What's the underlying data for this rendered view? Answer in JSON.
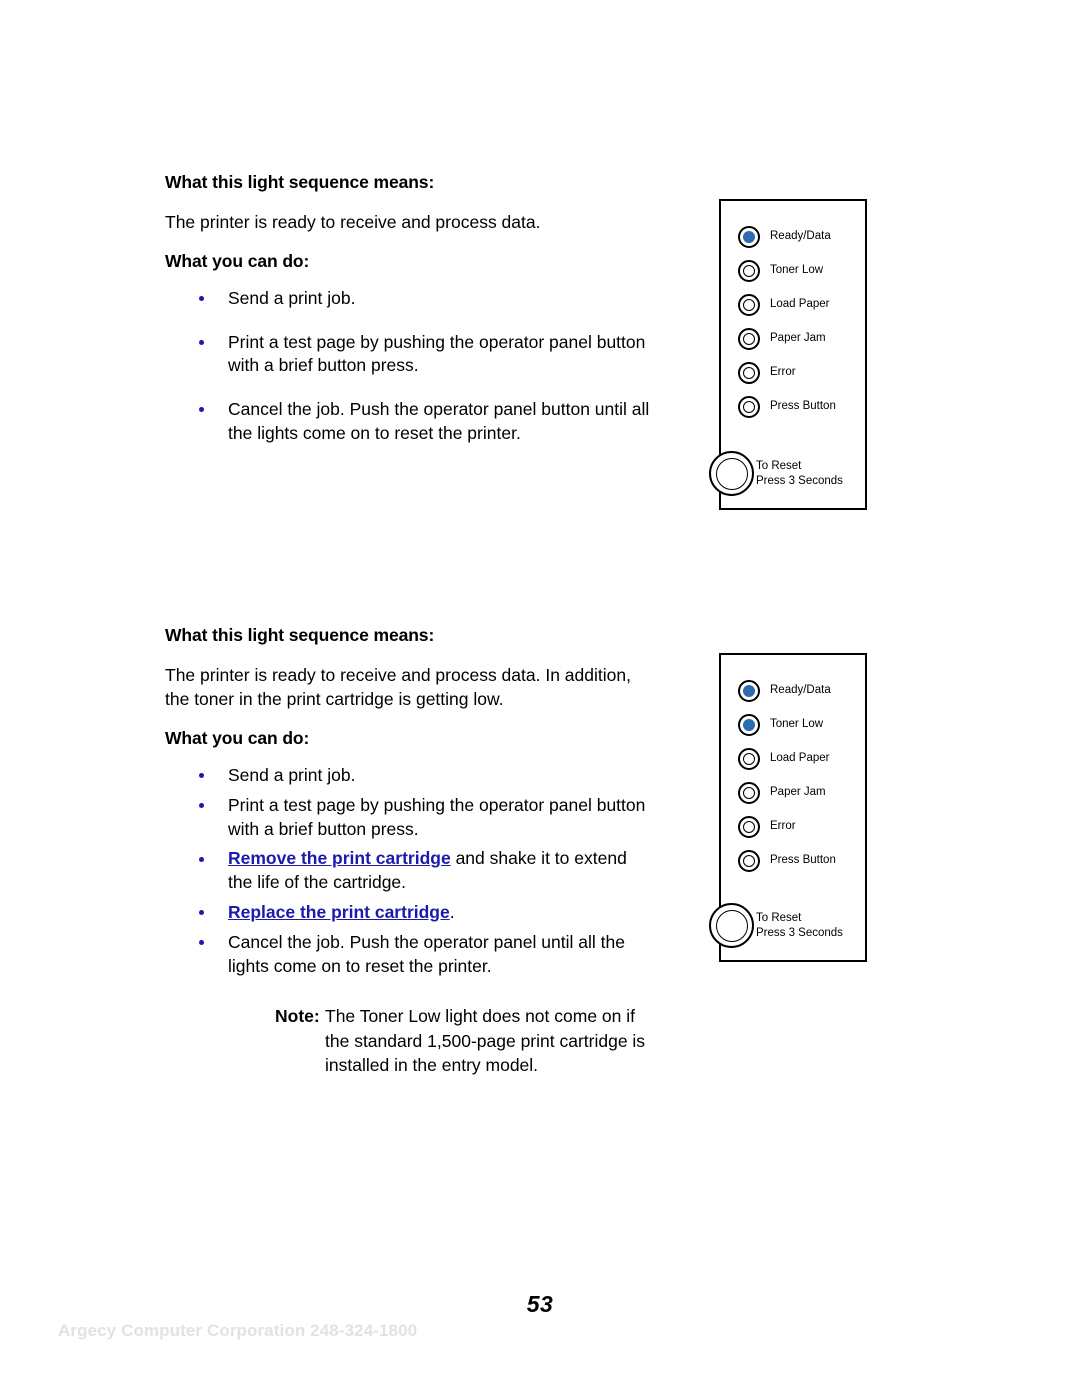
{
  "document": {
    "page_number": "53",
    "footer_credit": "Argecy Computer Corporation 248-324-1800"
  },
  "sections": [
    {
      "means_heading": "What this light sequence means:",
      "means_text": "The printer is ready to receive and process data.",
      "can_do_heading": "What you can do:",
      "bullets": [
        {
          "text": "Send a print job."
        },
        {
          "text": "Print a test page by pushing the operator panel button with a brief button press."
        },
        {
          "text": "Cancel the job. Push the operator panel button until all the lights come on to reset the printer."
        }
      ]
    },
    {
      "means_heading": "What this light sequence means:",
      "means_text": "The printer is ready to receive and process data. In addition, the toner in the print cartridge is getting low.",
      "can_do_heading": "What you can do:",
      "bullets": [
        {
          "text": "Send a print job."
        },
        {
          "text": "Print a test page by pushing the operator panel button with a brief button press."
        },
        {
          "link": "Remove the print cartridge",
          "text": " and shake it to extend the life of the cartridge."
        },
        {
          "link": "Replace the print cartridge",
          "text": "."
        },
        {
          "text": "Cancel the job. Push the operator panel until all the lights come on to reset the printer."
        }
      ],
      "note": {
        "label": "Note:",
        "text": "The Toner Low light does not come on if the standard 1,500-page print cartridge is installed in the entry model."
      }
    }
  ],
  "panels": [
    {
      "name": "operator-panel-ready",
      "leds": [
        {
          "label": "Ready/Data",
          "lit": true
        },
        {
          "label": "Toner Low",
          "lit": false
        },
        {
          "label": "Load Paper",
          "lit": false
        },
        {
          "label": "Paper Jam",
          "lit": false
        },
        {
          "label": "Error",
          "lit": false
        },
        {
          "label": "Press Button",
          "lit": false
        }
      ],
      "reset": {
        "line1": "To Reset",
        "line2": "Press 3 Seconds"
      }
    },
    {
      "name": "operator-panel-toner-low",
      "leds": [
        {
          "label": "Ready/Data",
          "lit": true
        },
        {
          "label": "Toner Low",
          "lit": true
        },
        {
          "label": "Load Paper",
          "lit": false
        },
        {
          "label": "Paper Jam",
          "lit": false
        },
        {
          "label": "Error",
          "lit": false
        },
        {
          "label": "Press Button",
          "lit": false
        }
      ],
      "reset": {
        "line1": "To Reset",
        "line2": "Press 3 Seconds"
      }
    }
  ],
  "colors": {
    "led_on": "#2a6cb0",
    "link": "#1a1aad",
    "bullet": "#1a1aad",
    "footer_credit": "#e2e2e2"
  }
}
